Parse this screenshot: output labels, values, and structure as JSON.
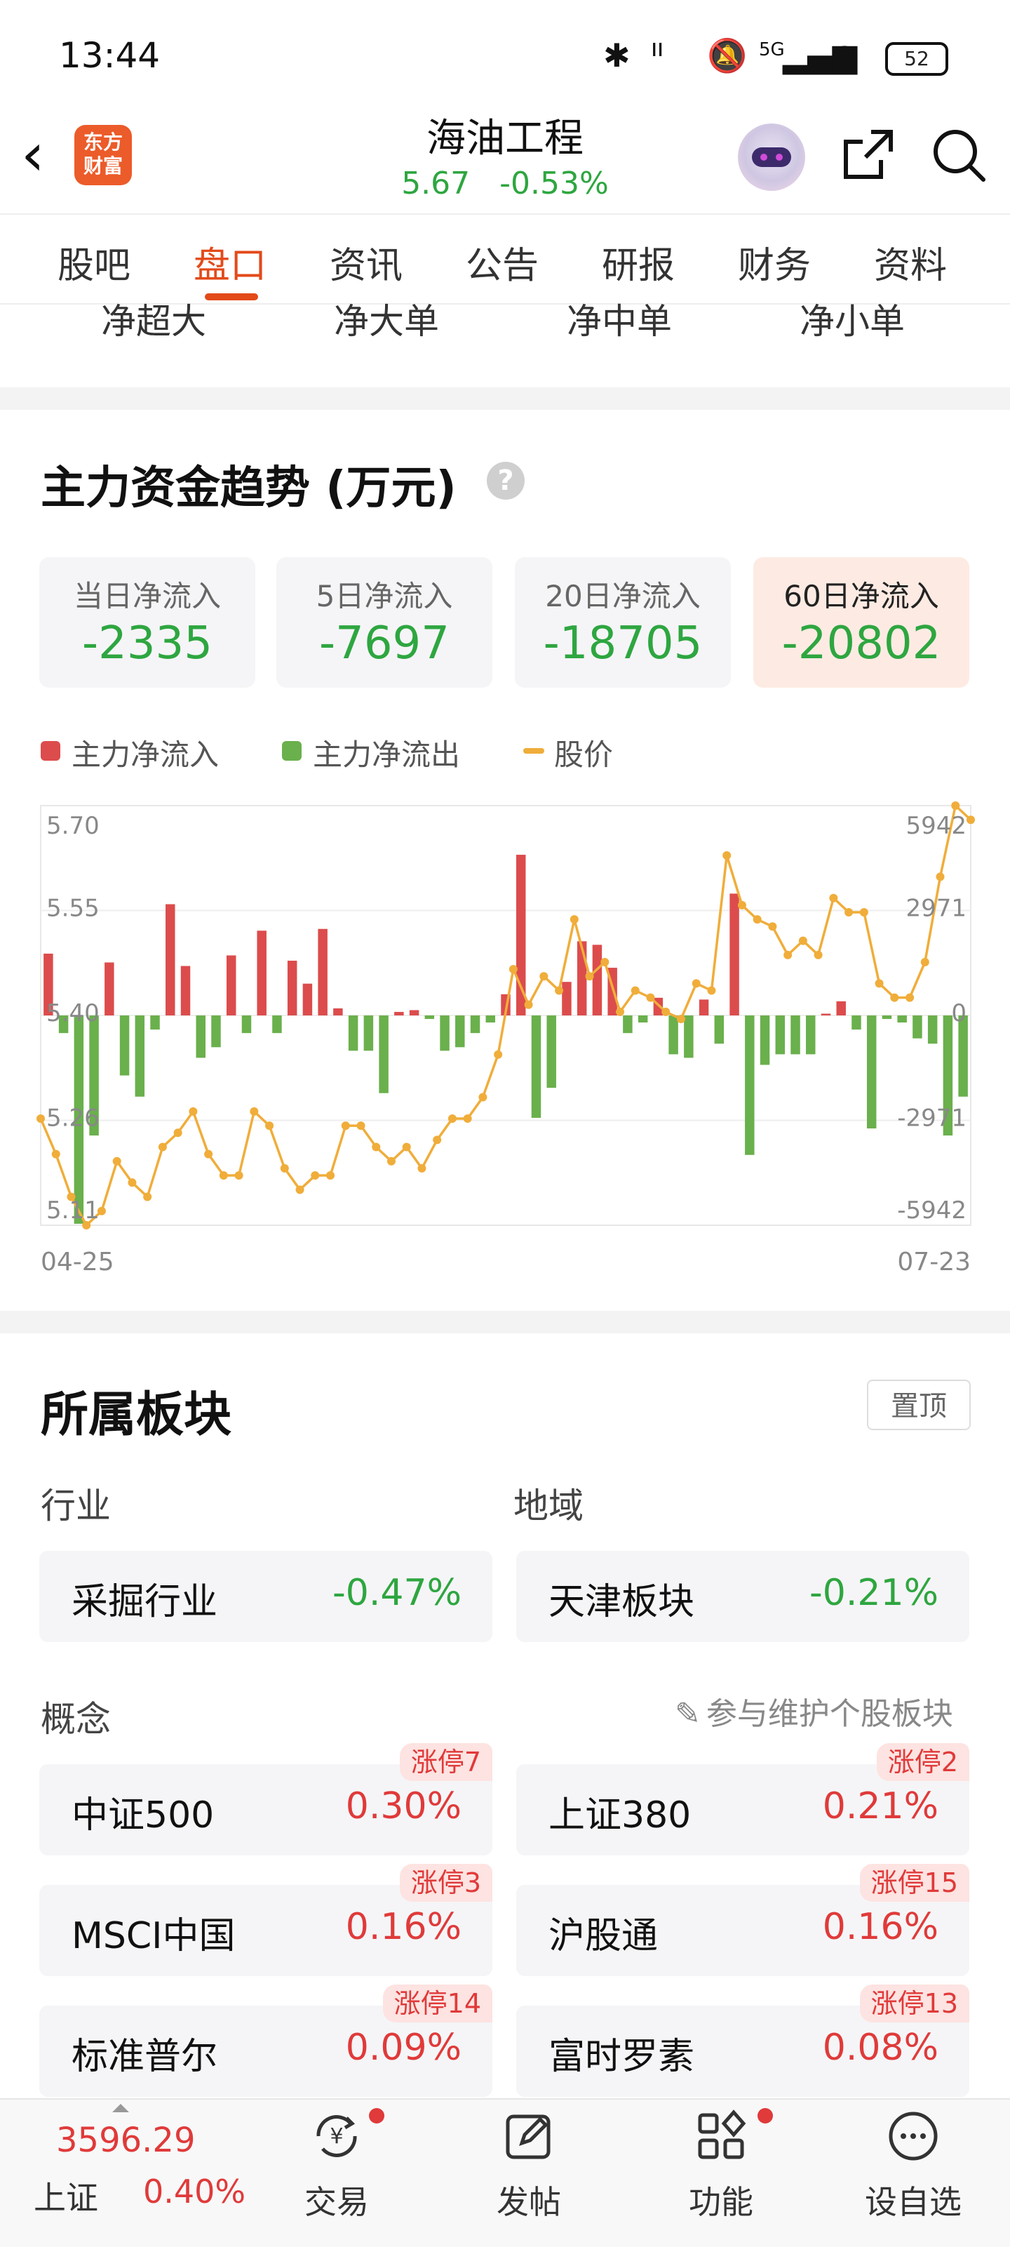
{
  "status_bar": {
    "time": "13:44",
    "battery": "52",
    "signal": "5G"
  },
  "header": {
    "logo_text": "东方财富",
    "stock_name": "海油工程",
    "price": "5.67",
    "change_pct": "-0.53%"
  },
  "tabs": [
    "股吧",
    "盘口",
    "资讯",
    "公告",
    "研报",
    "财务",
    "资料"
  ],
  "active_tab": "盘口",
  "order_types": [
    "净超大",
    "净大单",
    "净中单",
    "净小单"
  ],
  "fund_trend": {
    "title": "主力资金趋势 (万元)",
    "help": "?",
    "periods": [
      {
        "label": "当日净流入",
        "value": "-2335"
      },
      {
        "label": "5日净流入",
        "value": "-7697"
      },
      {
        "label": "20日净流入",
        "value": "-18705"
      },
      {
        "label": "60日净流入",
        "value": "-20802"
      }
    ],
    "active_period": "60日净流入",
    "legend": [
      "主力净流入",
      "主力净流出",
      "股价"
    ]
  },
  "chart_data": {
    "type": "bar",
    "start_label": "04-25",
    "end_label": "07-23",
    "left_axis_ticks": [
      "5.70",
      "5.55",
      "5.40",
      "5.26",
      "5.11"
    ],
    "right_axis_ticks": [
      "5942",
      "2971",
      "0",
      "-2971",
      "-5942"
    ],
    "price_range": [
      5.11,
      5.7
    ],
    "flow_range": [
      -5942,
      5942
    ],
    "series": [
      {
        "name": "主力净流入",
        "color": "#dc4c4c"
      },
      {
        "name": "主力净流出",
        "color": "#6ab04c"
      },
      {
        "name": "股价",
        "color": "#f0ad3a"
      }
    ],
    "net_flow": [
      1750,
      -500,
      -5900,
      -3400,
      1500,
      -1700,
      -2300,
      -400,
      3150,
      1400,
      -1200,
      -900,
      1700,
      -500,
      2400,
      -500,
      1550,
      900,
      2450,
      200,
      -1000,
      -1000,
      -2200,
      100,
      150,
      -100,
      -1000,
      -900,
      -500,
      -200,
      600,
      4550,
      -2900,
      -2050,
      950,
      2100,
      2000,
      1350,
      -500,
      -200,
      500,
      -1100,
      -1200,
      450,
      -800,
      3450,
      -3950,
      -1400,
      -1100,
      -1100,
      -1100,
      50,
      400,
      -400,
      -3200,
      -100,
      -200,
      -650,
      -800,
      -3400,
      -2300
    ],
    "price": [
      5.26,
      5.21,
      5.15,
      5.11,
      5.13,
      5.2,
      5.17,
      5.15,
      5.22,
      5.24,
      5.27,
      5.21,
      5.18,
      5.18,
      5.27,
      5.25,
      5.19,
      5.16,
      5.18,
      5.18,
      5.25,
      5.25,
      5.22,
      5.2,
      5.22,
      5.19,
      5.23,
      5.26,
      5.26,
      5.29,
      5.35,
      5.47,
      5.42,
      5.46,
      5.44,
      5.54,
      5.46,
      5.48,
      5.41,
      5.44,
      5.43,
      5.41,
      5.4,
      5.45,
      5.44,
      5.63,
      5.56,
      5.54,
      5.53,
      5.49,
      5.51,
      5.49,
      5.57,
      5.55,
      5.55,
      5.45,
      5.43,
      5.43,
      5.48,
      5.6,
      5.7,
      5.68
    ]
  },
  "sectors": {
    "title": "所属板块",
    "pin_top": "置顶",
    "industry_label": "行业",
    "region_label": "地域",
    "industry": {
      "name": "采掘行业",
      "change": "-0.47%"
    },
    "region": {
      "name": "天津板块",
      "change": "-0.21%"
    },
    "concept_label": "概念",
    "maintain_link": "参与维护个股板块",
    "concepts": [
      {
        "name": "中证500",
        "change": "0.30%",
        "badge": "涨停7"
      },
      {
        "name": "上证380",
        "change": "0.21%",
        "badge": "涨停2"
      },
      {
        "name": "MSCI中国",
        "change": "0.16%",
        "badge": "涨停3"
      },
      {
        "name": "沪股通",
        "change": "0.16%",
        "badge": "涨停15"
      },
      {
        "name": "标准普尔",
        "change": "0.09%",
        "badge": "涨停14"
      },
      {
        "name": "富时罗素",
        "change": "0.08%",
        "badge": "涨停13"
      }
    ]
  },
  "bottom_nav": {
    "index_value": "3596.29",
    "index_name": "上证",
    "index_change": "0.40%",
    "items": [
      "交易",
      "发帖",
      "功能",
      "设自选"
    ]
  },
  "colors": {
    "up": "#e03a3a",
    "down": "#2ea640",
    "accent": "#e34a1a",
    "price_line": "#f0ad3a"
  }
}
